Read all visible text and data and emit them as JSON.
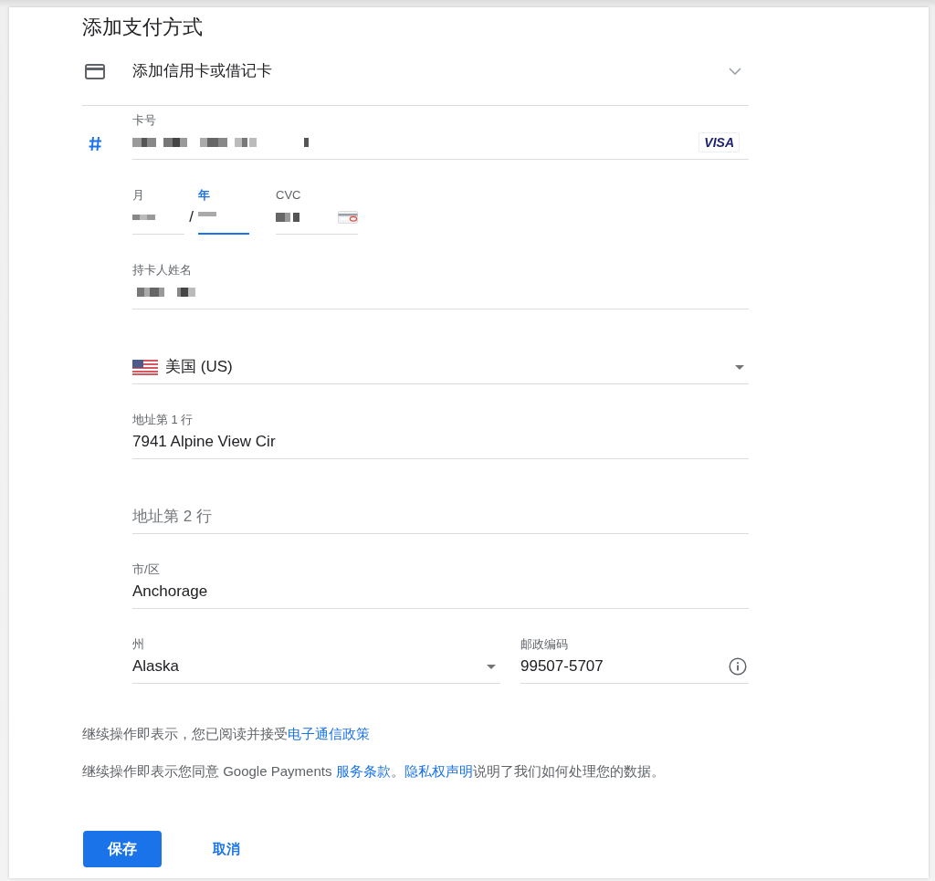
{
  "title": "添加支付方式",
  "payment_method": {
    "label": "添加信用卡或借记卡"
  },
  "card_number": {
    "label": "卡号",
    "focused": false,
    "redacted": true,
    "brand": "VISA"
  },
  "expiry": {
    "month": {
      "label": "月",
      "focused": false,
      "redacted": true
    },
    "separator": "/",
    "year": {
      "label": "年",
      "focused": true,
      "redacted": true
    }
  },
  "cvc": {
    "label": "CVC",
    "focused": false,
    "redacted": true
  },
  "cardholder": {
    "label": "持卡人姓名",
    "focused": false,
    "redacted": true
  },
  "country": {
    "value": "美国 (US)"
  },
  "address_fields": [
    {
      "label": "地址第 1 行",
      "value": "7941 Alpine View Cir",
      "focused": false
    },
    {
      "placeholder": "地址第 2 行",
      "focused": false
    },
    {
      "label": "市/区",
      "value": "Anchorage",
      "focused": false
    }
  ],
  "state": {
    "label": "州",
    "value": "Alaska"
  },
  "postal_code": {
    "label": "邮政编码",
    "value": "99507-5707",
    "focused": false
  },
  "notices": [
    {
      "parts": [
        {
          "text": "继续操作即表示，您已阅读并接受",
          "link": false
        },
        {
          "text": "电子通信政策",
          "link": true
        }
      ]
    },
    {
      "parts": [
        {
          "text": "继续操作即表示您同意 Google Payments ",
          "link": false
        },
        {
          "text": "服务条款",
          "link": true
        },
        {
          "text": "。",
          "link": false
        },
        {
          "text": "隐私权声明",
          "link": true
        },
        {
          "text": "说明了我们如何处理您的数据。",
          "link": false
        }
      ]
    }
  ],
  "buttons": [
    {
      "label": "保存",
      "kind": "primary"
    },
    {
      "label": "取消",
      "kind": "text"
    }
  ]
}
